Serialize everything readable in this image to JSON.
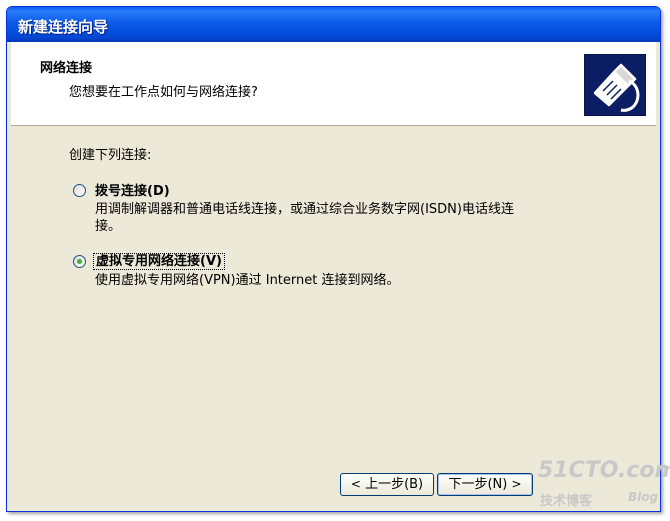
{
  "window": {
    "title": "新建连接向导"
  },
  "header": {
    "title": "网络连接",
    "subtitle": "您想要在工作点如何与网络连接?",
    "icon": "network-plug-icon"
  },
  "body": {
    "prompt": "创建下列连接:",
    "options": [
      {
        "label": "拨号连接(D)",
        "description_line1": "用调制解调器和普通电话线连接，或通过综合业务数字网(ISDN)电话线连",
        "description_line2": "接。",
        "selected": false
      },
      {
        "label": "虚拟专用网络连接(V)",
        "description_line1": "使用虚拟专用网络(VPN)通过 Internet 连接到网络。",
        "selected": true
      }
    ]
  },
  "footer": {
    "back_label": "上一步(B)",
    "next_label": "下一步(N)"
  },
  "watermark": {
    "line1": "51CTO.com",
    "line2": "技术博客",
    "line3": "Blog"
  },
  "colors": {
    "titlebar": "#0B5BE8",
    "dialog_bg": "#ECE9D8",
    "radio_selected": "#3BB230"
  }
}
